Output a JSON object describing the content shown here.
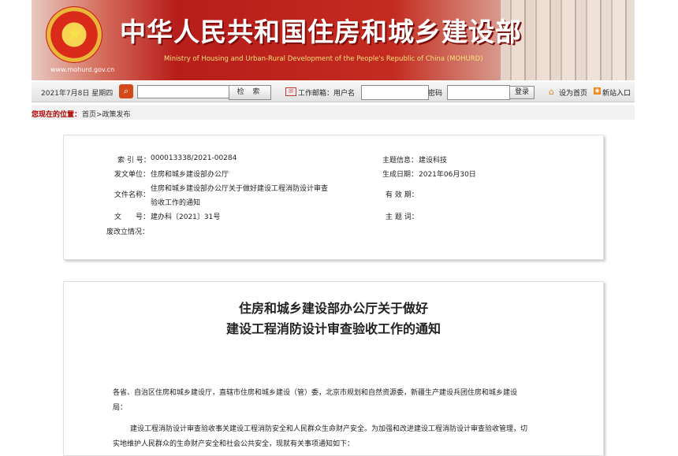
{
  "header": {
    "site_url": "www.mohurd.gov.cn",
    "title_cn": "中华人民共和国住房和城乡建设部",
    "title_en": "Ministry of Housing and Urban-Rural Development of the People's Republic of China (MOHURD)",
    "emblem_star": "★"
  },
  "toolbar": {
    "date": "2021年7月8日 星期四",
    "search_placeholder": "",
    "search_button": "检 索",
    "mail_label": "工作邮箱：用户名",
    "password_label": "密码",
    "login_button": "登录",
    "set_home_label": "设为首页",
    "rss_label": "新站入口"
  },
  "breadcrumb": {
    "label": "您现在的位置：",
    "path": "首页>政策发布"
  },
  "meta": {
    "index_no_label": "索 引 号：",
    "index_no": "000013338/2021-00284",
    "issuer_label": "发文单位：",
    "issuer": "住房和城乡建设部办公厅",
    "filename_label": "文件名称：",
    "filename_line1": "住房和城乡建设部办公厅关于做好建设工程消防设计审查",
    "filename_line2": "验收工作的通知",
    "doc_no_label": "文　　号：",
    "doc_no": "建办科〔2021〕31号",
    "status_label": "废改立情况：",
    "topic_label": "主题信息：",
    "topic": "建设科技",
    "date_label": "生成日期：",
    "date": "2021年06月30日",
    "validity_label": "有 效 期：",
    "keywords_label": "主 题 词："
  },
  "doc": {
    "title_line1": "住房和城乡建设部办公厅关于做好",
    "title_line2": "建设工程消防设计审查验收工作的通知",
    "para1_line1": "各省、自治区住房和城乡建设厅，直辖市住房和城乡建设（管）委，北京市规划和自然资源委，新疆生产建设兵团住房和城乡建设",
    "para1_line2": "局：",
    "para2_line1": "建设工程消防设计审查验收事关建设工程消防安全和人民群众生命财产安全。为加强和改进建设工程消防设计审查验收管理，切",
    "para2_line2": "实地维护人民群众的生命财产安全和社会公共安全，现就有关事项通知如下："
  }
}
